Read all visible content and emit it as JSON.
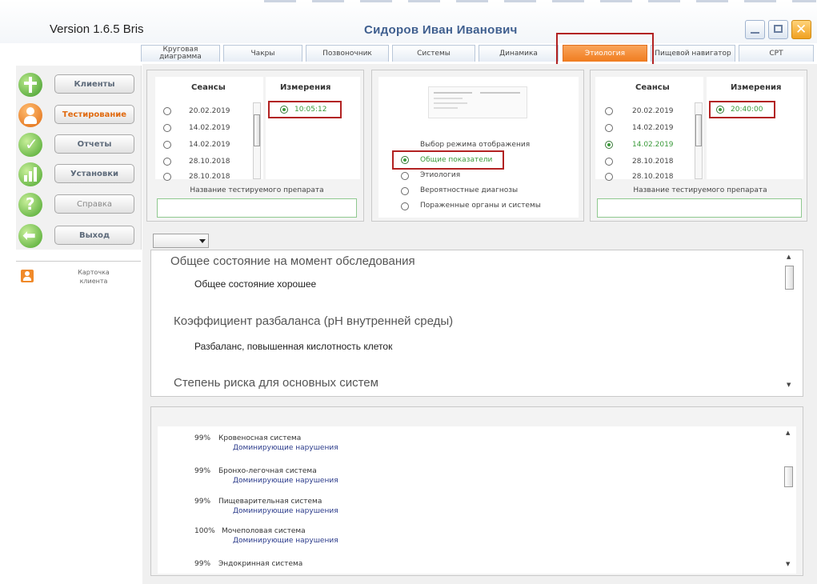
{
  "window": {
    "version": "Version 1.6.5 Bris",
    "patient_name": "Сидоров Иван Иванович"
  },
  "tabs": [
    {
      "label": "Круговая диаграмма"
    },
    {
      "label": "Чакры"
    },
    {
      "label": "Позвоночник"
    },
    {
      "label": "Системы"
    },
    {
      "label": "Динамика"
    },
    {
      "label": "Этиология"
    },
    {
      "label": "Пищевой навигатор"
    },
    {
      "label": "CPT"
    }
  ],
  "sidebar": {
    "items": [
      {
        "label": "Клиенты",
        "icon": "cross-icon"
      },
      {
        "label": "Тестирование",
        "icon": "person-icon"
      },
      {
        "label": "Отчеты",
        "icon": "checkmark-icon"
      },
      {
        "label": "Установки",
        "icon": "chart-icon"
      },
      {
        "label": "Справка",
        "icon": "question-icon"
      },
      {
        "label": "Выход",
        "icon": "exit-arrow-icon"
      }
    ],
    "card_label": "Карточка клиента"
  },
  "left_panel": {
    "sessions_header": "Сеансы",
    "measurements_header": "Измерения",
    "sessions": [
      "20.02.2019",
      "14.02.2019",
      "14.02.2019",
      "28.10.2018",
      "28.10.2018"
    ],
    "measurement": "10:05:12",
    "drug_label": "Название тестируемого препарата",
    "drug_value": ""
  },
  "middle_panel": {
    "mode_title": "Выбор режима отображения",
    "modes": [
      "Общие показатели",
      "Этиология",
      "Вероятностные диагнозы",
      "Пораженные органы и системы"
    ],
    "selected_mode": 0
  },
  "right_panel": {
    "sessions_header": "Сеансы",
    "measurements_header": "Измерения",
    "sessions": [
      "20.02.2019",
      "14.02.2019",
      "14.02.2019",
      "28.10.2018",
      "28.10.2018"
    ],
    "selected_session": 2,
    "measurement": "20:40:00",
    "drug_label": "Название тестируемого препарата",
    "drug_value": ""
  },
  "report": {
    "dropdown_value": "",
    "sections": [
      {
        "title": "Общее состояние на момент обследования",
        "body": "Общее состояние хорошее"
      },
      {
        "title": "Коэффициент разбаланса (pH внутренней среды)",
        "body": "Разбаланс, повышенная кислотность клеток"
      },
      {
        "title": "Степень риска для основных систем",
        "body": ""
      }
    ]
  },
  "systems": [
    {
      "percent": "99%",
      "name": "Кровеносная система",
      "note": "Доминирующие нарушения"
    },
    {
      "percent": "99%",
      "name": "Бронхо-легочная система",
      "note": "Доминирующие нарушения"
    },
    {
      "percent": "99%",
      "name": "Пищеварительная система",
      "note": "Доминирующие нарушения"
    },
    {
      "percent": "100%",
      "name": "Мочеполовая система",
      "note": "Доминирующие нарушения"
    },
    {
      "percent": "99%",
      "name": "Эндокринная система",
      "note": ""
    }
  ],
  "colors": {
    "accent_orange": "#f07c1e",
    "highlight_red": "#b22222",
    "active_green": "#3a9a3a",
    "title_blue": "#3f5f8f"
  }
}
